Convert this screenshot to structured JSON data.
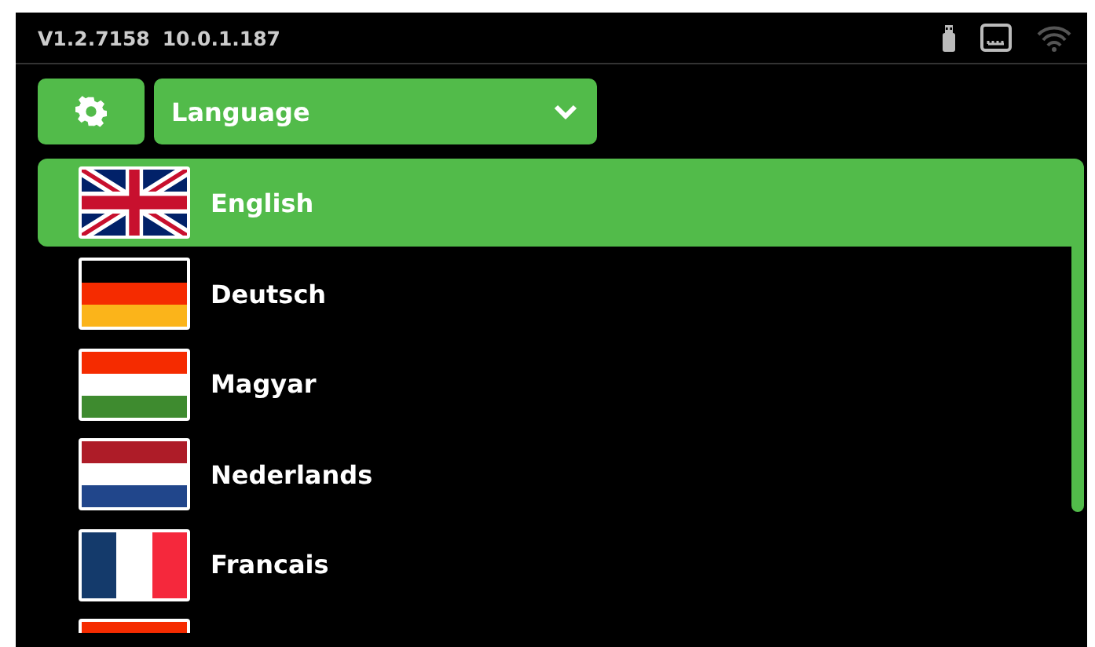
{
  "status_bar": {
    "version": "V1.2.7158",
    "ip": "10.0.1.187"
  },
  "toolbar": {
    "dropdown": {
      "label": "Language"
    }
  },
  "languages": [
    {
      "label": "English",
      "kind": "uk",
      "selected": true
    },
    {
      "label": "Deutsch",
      "kind": "de",
      "selected": false
    },
    {
      "label": "Magyar",
      "kind": "hu",
      "selected": false
    },
    {
      "label": "Nederlands",
      "kind": "nl",
      "selected": false
    },
    {
      "label": "Francais",
      "kind": "fr",
      "selected": false
    },
    {
      "kind": "partial",
      "selected": false
    }
  ]
}
